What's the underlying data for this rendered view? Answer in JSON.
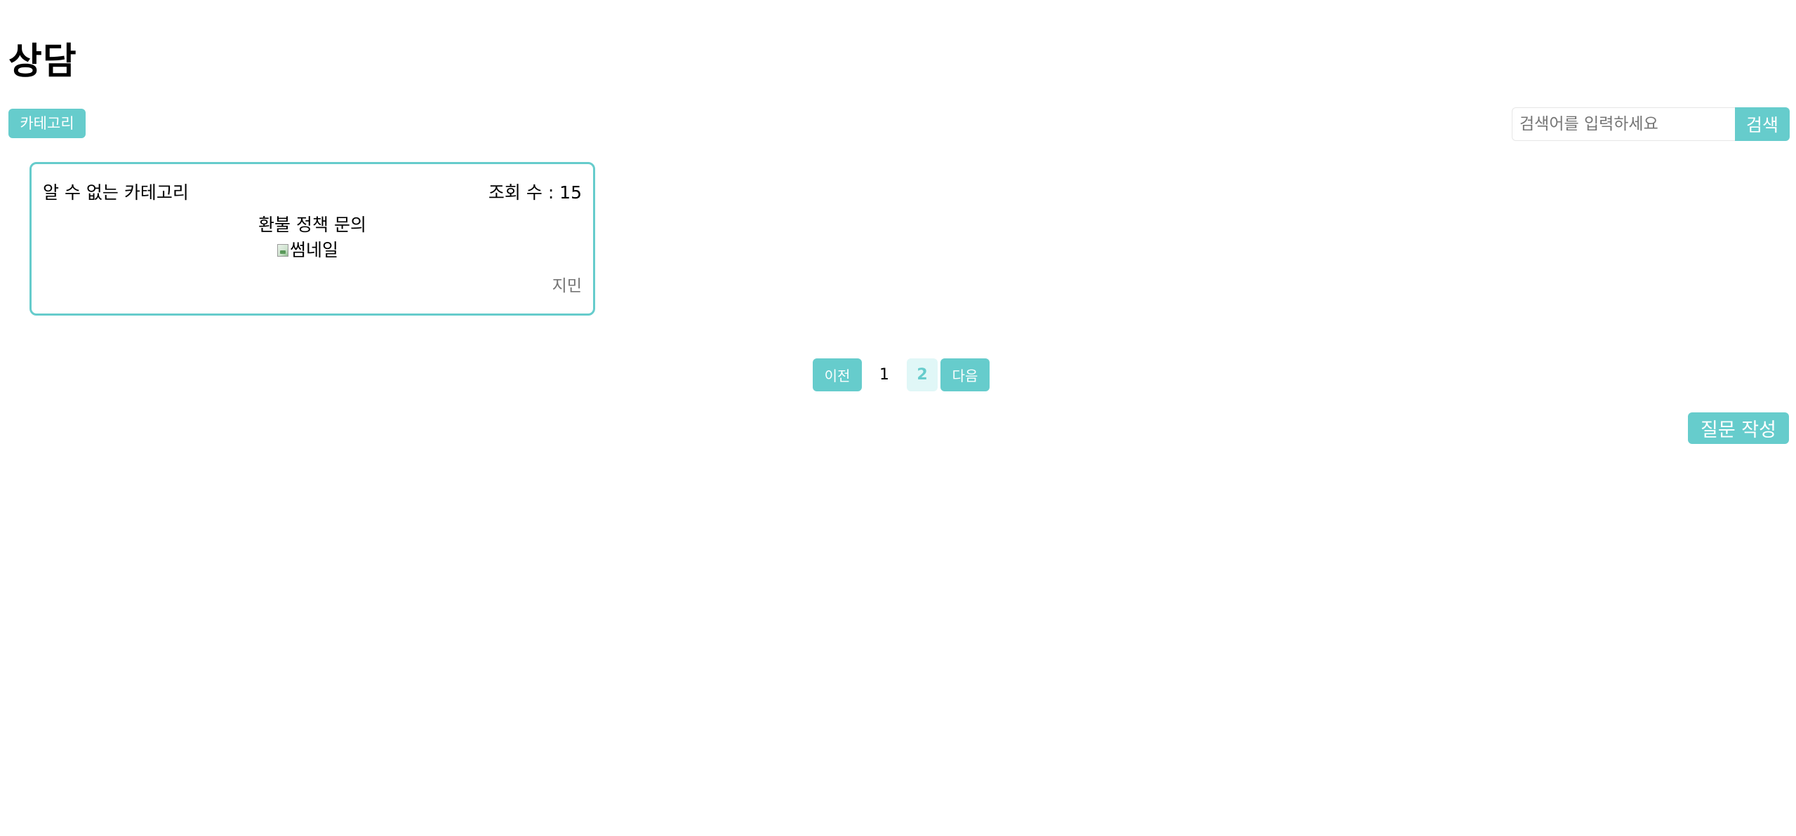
{
  "page": {
    "title": "상담"
  },
  "toolbar": {
    "category_label": "카테고리",
    "search_placeholder": "검색어를 입력하세요",
    "search_value": "",
    "search_label": "검색"
  },
  "posts": [
    {
      "category": "알 수 없는 카테고리",
      "views": "조회 수 : 15",
      "title": "환불 정책 문의",
      "thumbnail_alt": "썸네일",
      "author": "지민"
    }
  ],
  "pagination": {
    "prev_label": "이전",
    "pages": [
      "1",
      "2"
    ],
    "active_page": "2",
    "next_label": "다음"
  },
  "actions": {
    "write_label": "질문 작성"
  },
  "colors": {
    "accent": "#66cccc",
    "active_page_bg": "#e0f7f7",
    "muted_text": "#757575"
  }
}
